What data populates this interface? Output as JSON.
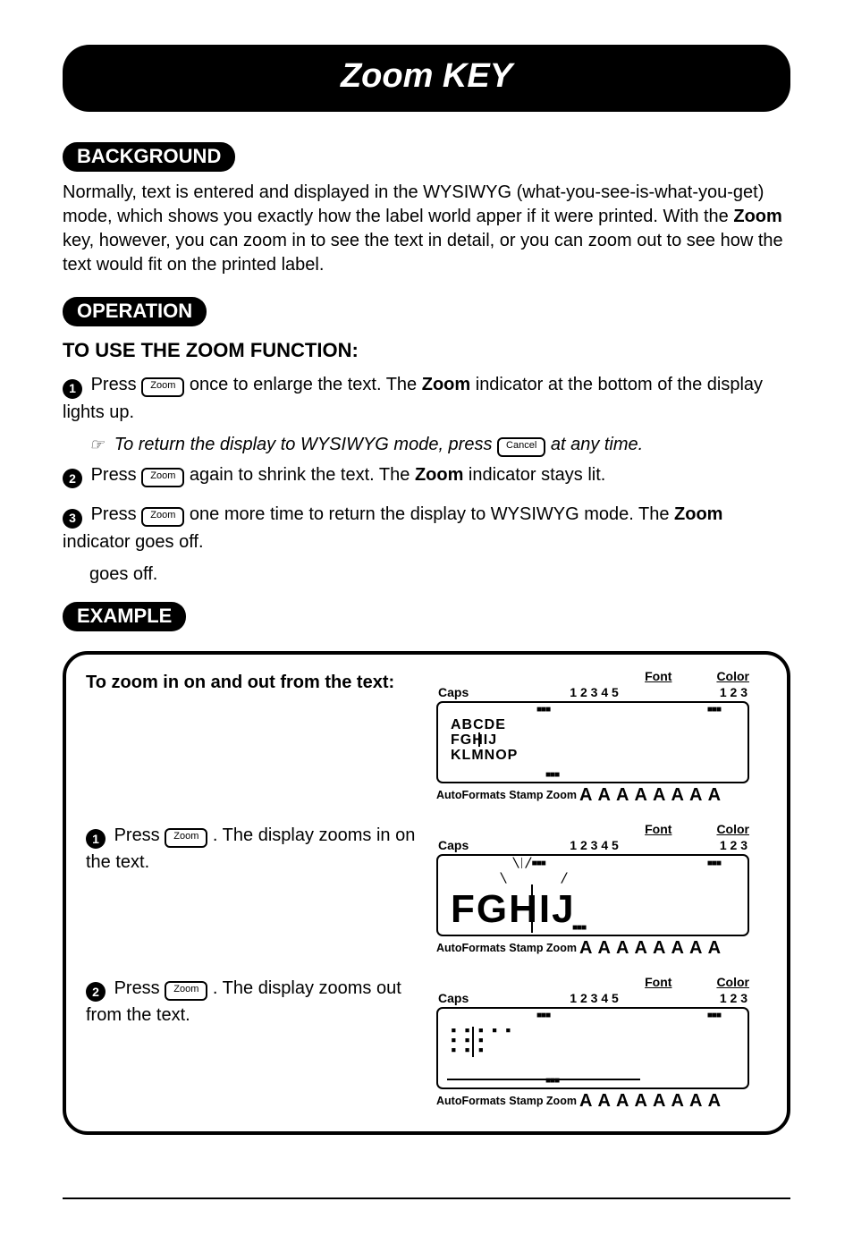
{
  "title": "Zoom KEY",
  "section_background_label": "BACKGROUND",
  "background_text_a": "Normally, text is entered and displayed in the WYSIWYG (what-you-see-is-what-you-get) mode, which shows you exactly how the label world apper if it were printed.  With the ",
  "background_text_b_bold": "Zoom",
  "background_text_c": " key, however, you can zoom in to see the text in detail, or you can zoom out to see how the text would fit on the printed label.",
  "section_operation_label": "OPERATION",
  "operation_subhead": "TO USE THE ZOOM FUNCTION:",
  "key_zoom": "Zoom",
  "key_cancel": "Cancel",
  "step1_a": "Press ",
  "step1_b": " once to enlarge the text. The ",
  "step1_bold": "Zoom",
  "step1_c": " indicator at the bottom of the display lights up.",
  "step1_note_a": "To return the display to WYSIWYG mode, press ",
  "step1_note_b": " at any time.",
  "step2_a": "Press ",
  "step2_b": " again to shrink the text.  The ",
  "step2_bold": "Zoom",
  "step2_c": " indicator stays lit.",
  "step3_a": "Press ",
  "step3_b": " one more time to return the display to WYSIWYG mode. The ",
  "step3_bold": "Zoom",
  "step3_c": " indicator goes off.",
  "section_example_label": "EXAMPLE",
  "example_title": "To zoom in on and out from the text:",
  "ex1_a": "Press ",
  "ex1_b": " .  The display zooms in on the text.",
  "ex2_a": "Press ",
  "ex2_b": " .  The display zooms out from the text.",
  "lcd": {
    "font_label": "Font",
    "color_label": "Color",
    "caps_label": "Caps",
    "font_nums": "1 2 3 4 5",
    "color_nums": "1 2 3",
    "bottom_labels": "AutoFormats Stamp Zoom",
    "bottom_as": "A A A A  A A A A",
    "screen1_line1": "ABCDE",
    "screen1_line2": "FGHIJ",
    "screen1_line3": "KLMNOP",
    "screen2_big": "FGHIJ",
    "screen3_blob_l1": "▪ ▪ ▪  ▪ ▪",
    "screen3_blob_l2": "▪ ▪   ▪",
    "screen3_blob_l3": "  ▪ ▪ ▪"
  }
}
